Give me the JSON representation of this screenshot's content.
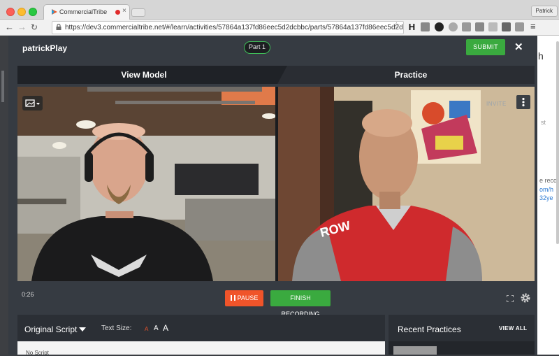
{
  "browser": {
    "tab_title": "CommercialTribe",
    "user_name": "Patrick",
    "url": "https://dev3.commercialtribe.net/#/learn/activities/57864a137fd86eec5d2dcbbc/parts/57864a137fd86eec5d2d...",
    "extension_h": "H"
  },
  "modal": {
    "name": "patrickPlay",
    "part_label": "Part 1",
    "submit_label": "SUBMIT"
  },
  "tabs": {
    "view_model": "View Model",
    "practice": "Practice"
  },
  "video": {
    "invite_label": "INVITE"
  },
  "controls": {
    "timer": "0:26",
    "pause_label": "PAUSE",
    "finish_label": "FINISH RECORDING"
  },
  "script": {
    "title": "Original Script",
    "text_size_label": "Text Size:",
    "size_a": "A",
    "no_script": "No Script"
  },
  "recent": {
    "title": "Recent Practices",
    "view_all": "VIEW ALL"
  },
  "background_page": {
    "heading_fragment": "h",
    "muted_fragment": "st",
    "text_fragment": "e recor",
    "link_fragments": [
      "om/h",
      "32ye"
    ]
  },
  "colors": {
    "accent_green": "#3aaa3f",
    "pause_orange": "#f0542a",
    "modal_bg": "#363b42"
  }
}
